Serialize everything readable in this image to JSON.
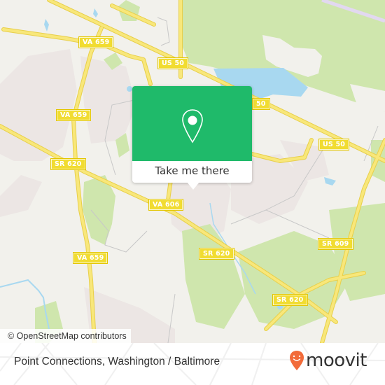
{
  "map": {
    "colors": {
      "background": "#f2f1ec",
      "park": "#cfe6ad",
      "residential": "#ece6e4",
      "water": "#a8d8f0",
      "road_major": "#f5e16a",
      "road_minor": "#c8c8c8",
      "rail": "#e2d8f0"
    },
    "route_labels": [
      {
        "id": "va659-top",
        "text": "VA 659"
      },
      {
        "id": "us50-top",
        "text": "US 50"
      },
      {
        "id": "va659-mid",
        "text": "VA 659"
      },
      {
        "id": "us50-center",
        "text": "50"
      },
      {
        "id": "us50-right",
        "text": "US 50"
      },
      {
        "id": "sr620-left",
        "text": "SR 620"
      },
      {
        "id": "va606",
        "text": "VA 606"
      },
      {
        "id": "sr609",
        "text": "SR 609"
      },
      {
        "id": "sr620-mid",
        "text": "SR 620"
      },
      {
        "id": "va659-low",
        "text": "VA 659"
      },
      {
        "id": "sr620-low",
        "text": "SR 620"
      }
    ],
    "attribution": "© OpenStreetMap contributors"
  },
  "popup": {
    "icon": "map-pin-icon",
    "button_label": "Take me there",
    "accent": "#1fba6a"
  },
  "footer": {
    "place_title": "Point Connections, Washington / Baltimore",
    "brand_name": "moovit",
    "brand_icon": "moovit-pin-logo-icon",
    "brand_color": "#f26b3a"
  }
}
